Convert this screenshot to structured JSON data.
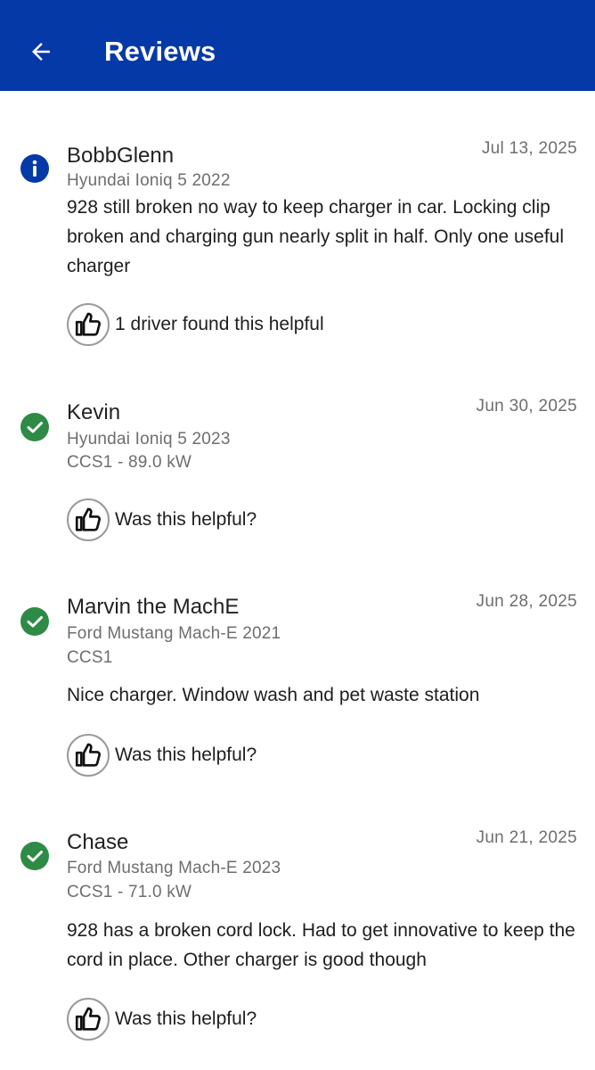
{
  "header": {
    "title": "Reviews",
    "background_color": "#0639a8"
  },
  "colors": {
    "info": "#0639a8",
    "verified": "#2e8b45"
  },
  "reviews": [
    {
      "status_icon": "info-icon",
      "author": "BobbGlenn",
      "date": "Jul 13, 2025",
      "vehicle": "Hyundai Ioniq 5 2022",
      "connector": "",
      "text": "928 still broken no way to keep charger in car. Locking clip broken and charging gun nearly split in half. Only one useful charger",
      "helpful_label": "1 driver found this helpful"
    },
    {
      "status_icon": "check-circle-icon",
      "author": "Kevin",
      "date": "Jun 30, 2025",
      "vehicle": "Hyundai Ioniq 5 2023",
      "connector": "CCS1 - 89.0 kW",
      "text": "",
      "helpful_label": "Was this helpful?"
    },
    {
      "status_icon": "check-circle-icon",
      "author": "Marvin the MachE",
      "date": "Jun 28, 2025",
      "vehicle": "Ford Mustang Mach-E 2021",
      "connector": "CCS1",
      "text": "Nice charger. Window wash and pet waste station",
      "helpful_label": "Was this helpful?"
    },
    {
      "status_icon": "check-circle-icon",
      "author": "Chase",
      "date": "Jun 21, 2025",
      "vehicle": "Ford Mustang Mach-E 2023",
      "connector": "CCS1 - 71.0 kW",
      "text": "928 has a broken cord lock. Had to get innovative to keep the cord in place. Other charger is good though",
      "helpful_label": "Was this helpful?"
    }
  ]
}
